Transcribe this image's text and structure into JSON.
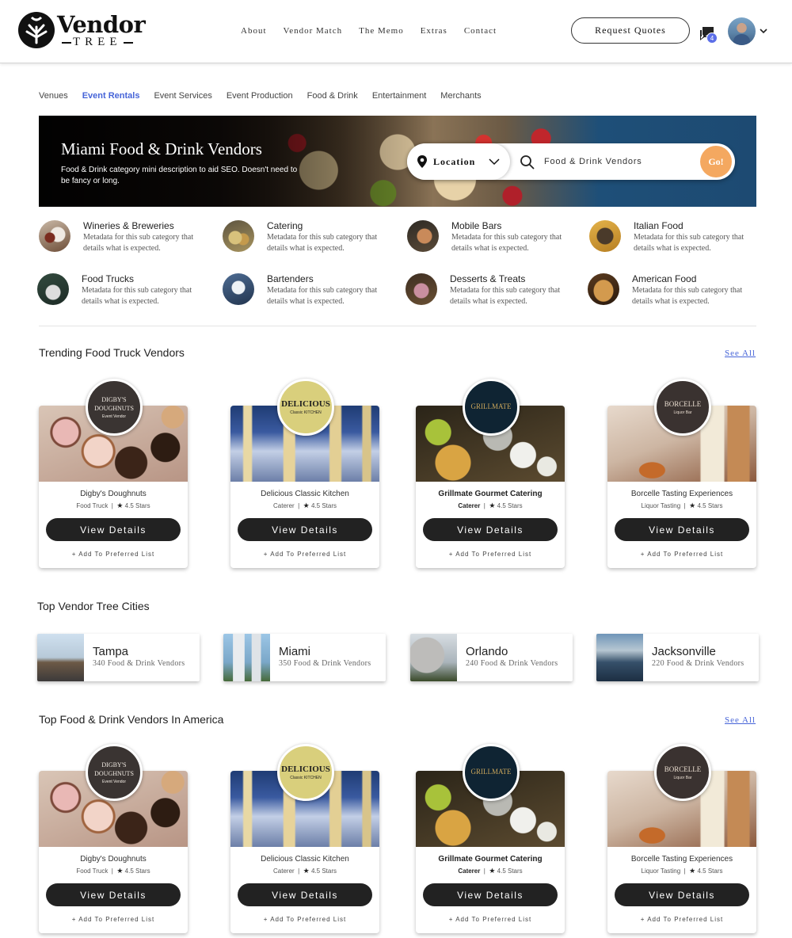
{
  "header": {
    "logo_word1": "Vendor",
    "logo_word2": "TREE",
    "nav": [
      "About",
      "Vendor Match",
      "The Memo",
      "Extras",
      "Contact"
    ],
    "request_quotes": "Request Quotes",
    "message_count": "4",
    "icons": [
      "tree-logo-icon",
      "chat-icon",
      "chevron-down-icon"
    ]
  },
  "category_tabs": [
    "Venues",
    "Event Rentals",
    "Event Services",
    "Event Production",
    "Food & Drink",
    "Entertainment",
    "Merchants"
  ],
  "active_tab": "Event Rentals",
  "hero": {
    "title": "Miami Food & Drink Vendors",
    "description": "Food & Drink category mini description to aid SEO. Doesn't need to be fancy or long.",
    "location_label": "Location",
    "search_value": "Food & Drink Vendors",
    "go_label": "Go!",
    "accent": "#f4a860"
  },
  "subcategories": [
    {
      "name": "Wineries & Breweries",
      "meta": "Metadata for this sub category that details what is expected."
    },
    {
      "name": "Catering",
      "meta": "Metadata for this sub category that details what is expected."
    },
    {
      "name": "Mobile Bars",
      "meta": "Metadata for this sub category that details what is expected."
    },
    {
      "name": "Italian Food",
      "meta": "Metadata for this sub category that details what is expected."
    },
    {
      "name": "Food Trucks",
      "meta": "Metadata for this sub category that details what is expected."
    },
    {
      "name": "Bartenders",
      "meta": "Metadata for this sub category that details what is expected."
    },
    {
      "name": "Desserts & Treats",
      "meta": "Metadata for this sub category that details what is expected."
    },
    {
      "name": "American Food",
      "meta": "Metadata for this sub category that details what is expected."
    }
  ],
  "trending": {
    "title": "Trending Food Truck Vendors",
    "see_all": "See All"
  },
  "cities_section": {
    "title": "Top Vendor Tree Cities",
    "cities": [
      {
        "name": "Tampa",
        "count": "340 Food & Drink Vendors"
      },
      {
        "name": "Miami",
        "count": "350 Food & Drink Vendors"
      },
      {
        "name": "Orlando",
        "count": "240 Food & Drink Vendors"
      },
      {
        "name": "Jacksonville",
        "count": "220 Food & Drink Vendors"
      }
    ]
  },
  "top_america": {
    "title": "Top Food & Drink Vendors In America",
    "see_all": "See All"
  },
  "vendors": [
    {
      "name": "Digby's Doughnuts",
      "type": "Food Truck",
      "rating": "4.5 Stars",
      "logo_line1": "DIGBY'S DOUGHNUTS",
      "logo_line2": "Event Vendor"
    },
    {
      "name": "Delicious Classic Kitchen",
      "type": "Caterer",
      "rating": "4.5 Stars",
      "logo_line1": "DELICIOUS",
      "logo_line2": "Classic KITCHEN"
    },
    {
      "name": "Grillmate Gourmet Catering",
      "type": "Caterer",
      "rating": "4.5 Stars",
      "logo_line1": "GRILLMATE",
      "logo_line2": ""
    },
    {
      "name": "Borcelle Tasting Experiences",
      "type": "Liquor Tasting",
      "rating": "4.5 Stars",
      "logo_line1": "BORCELLE",
      "logo_line2": "Liquor Bar"
    }
  ],
  "card_actions": {
    "view_details": "View Details",
    "add_preferred": "+ Add To Preferred List"
  }
}
